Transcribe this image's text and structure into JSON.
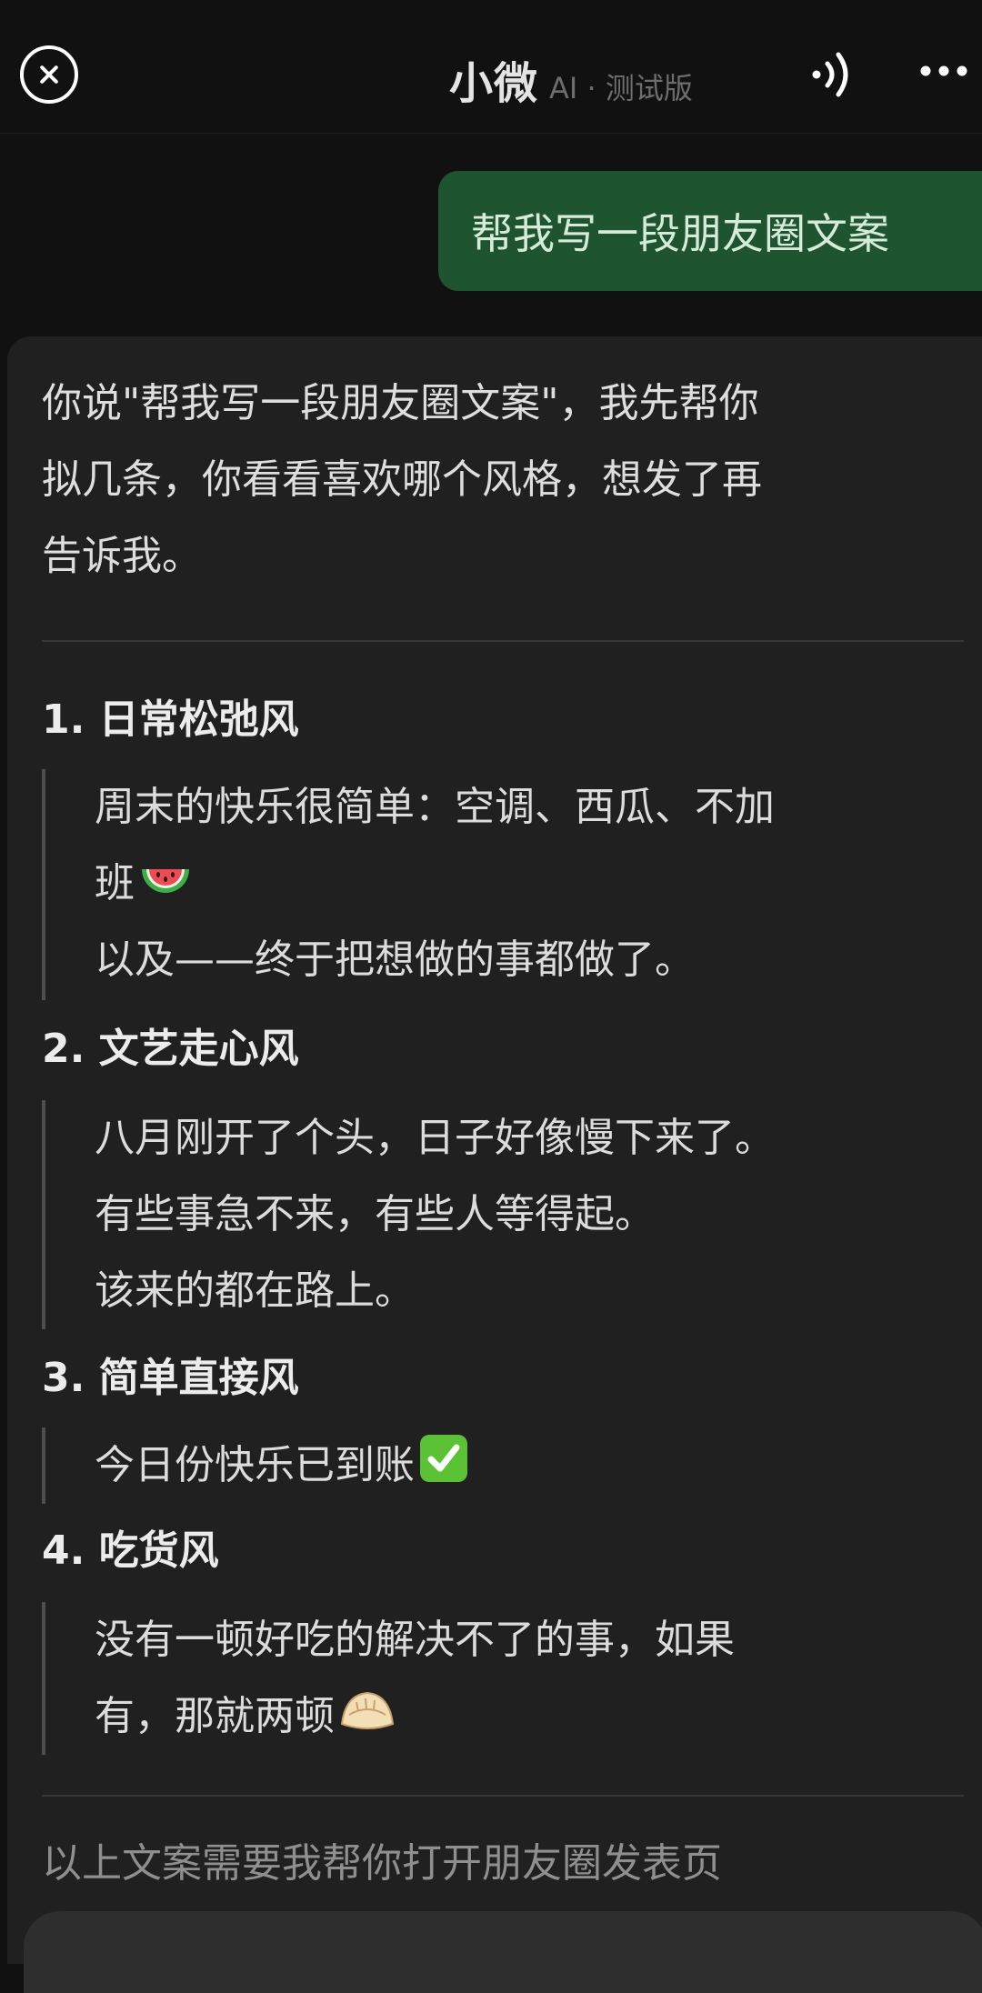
{
  "header": {
    "title": "小微",
    "subtitle": "AI · 测试版",
    "close_icon": "close-circle-icon",
    "voice_icon": "sound-wave-icon",
    "more_icon": "more-dots-icon"
  },
  "user_message": {
    "text": "帮我写一段朋友圈文案"
  },
  "ai_message": {
    "intro_lines": [
      "你说\"帮我写一段朋友圈文案\"，我先帮你",
      "拟几条，你看看喜欢哪个风格，想发了再",
      "告诉我。"
    ],
    "styles": [
      {
        "heading": "1. 日常松弛风",
        "lines": [
          "周末的快乐很简单：空调、西瓜、不加",
          "班",
          "以及——终于把想做的事都做了。"
        ],
        "emoji": "watermelon-emoji"
      },
      {
        "heading": "2. 文艺走心风",
        "lines": [
          "八月刚开了个头，日子好像慢下来了。",
          "有些事急不来，有些人等得起。",
          "该来的都在路上。"
        ]
      },
      {
        "heading": "3. 简单直接风",
        "lines": [
          "今日份快乐已到账"
        ],
        "emoji": "check-mark-emoji"
      },
      {
        "heading": "4. 吃货风",
        "lines": [
          "没有一顿好吃的解决不了的事，如果",
          "有，那就两顿"
        ],
        "emoji": "dumpling-emoji"
      }
    ],
    "footer": "以上文案需要我帮你打开朋友圈发表页"
  },
  "colors": {
    "background": "#111111",
    "user_bubble": "#1e5530",
    "ai_card": "#202020"
  }
}
